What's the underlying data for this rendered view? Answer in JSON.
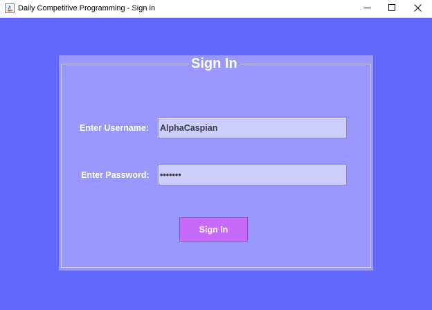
{
  "window": {
    "title": "Daily Competitive Programming - Sign in",
    "background_color": "#6366fb",
    "app_icon": "java-coffee-icon",
    "controls": {
      "minimize_icon": "minimize-icon",
      "maximize_icon": "maximize-icon",
      "close_icon": "close-icon"
    }
  },
  "form": {
    "heading": "Sign In",
    "panel_color": "#9898fe",
    "username_label": "Enter Username:",
    "username_value": "AlphaCaspian",
    "password_label": "Enter Password:",
    "password_value": "•••••••",
    "field_color": "#cdcdfc",
    "submit_label": "Sign In",
    "submit_color": "#c86af9"
  }
}
